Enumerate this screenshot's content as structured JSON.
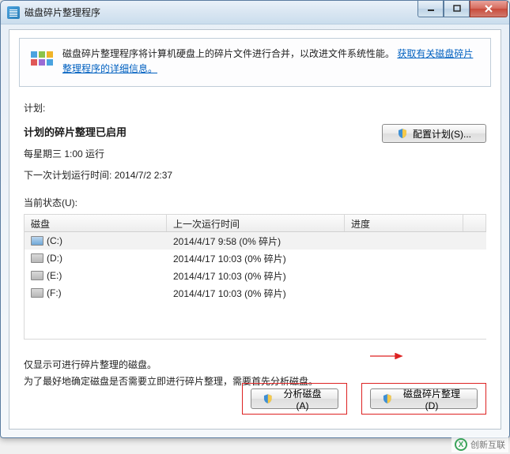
{
  "window": {
    "title": "磁盘碎片整理程序"
  },
  "banner": {
    "text_before_link": "磁盘碎片整理程序将计算机硬盘上的碎片文件进行合并，以改进文件系统性能。",
    "link_text": "获取有关磁盘碎片整理程序的详细信息。"
  },
  "plan_label": "计划:",
  "schedule": {
    "title": "计划的碎片整理已启用",
    "line1": "每星期三  1:00 运行",
    "line2_label": "下一次计划运行时间:",
    "line2_value": "2014/7/2 2:37",
    "config_btn": "配置计划(S)..."
  },
  "status_label": "当前状态(U):",
  "table": {
    "headers": {
      "disk": "磁盘",
      "last": "上一次运行时间",
      "progress": "进度"
    },
    "rows": [
      {
        "name": "(C:)",
        "last": "2014/4/17 9:58 (0% 碎片)",
        "selected": true,
        "kind": "c"
      },
      {
        "name": "(D:)",
        "last": "2014/4/17 10:03 (0% 碎片)",
        "selected": false,
        "kind": "hdd"
      },
      {
        "name": "(E:)",
        "last": "2014/4/17 10:03 (0% 碎片)",
        "selected": false,
        "kind": "hdd"
      },
      {
        "name": "(F:)",
        "last": "2014/4/17 10:03 (0% 碎片)",
        "selected": false,
        "kind": "hdd"
      }
    ]
  },
  "footer": {
    "line1": "仅显示可进行碎片整理的磁盘。",
    "line2": "为了最好地确定磁盘是否需要立即进行碎片整理，需要首先分析磁盘。"
  },
  "actions": {
    "analyze": "分析磁盘(A)",
    "defrag": "磁盘碎片整理(D)"
  },
  "watermark": "创新互联"
}
